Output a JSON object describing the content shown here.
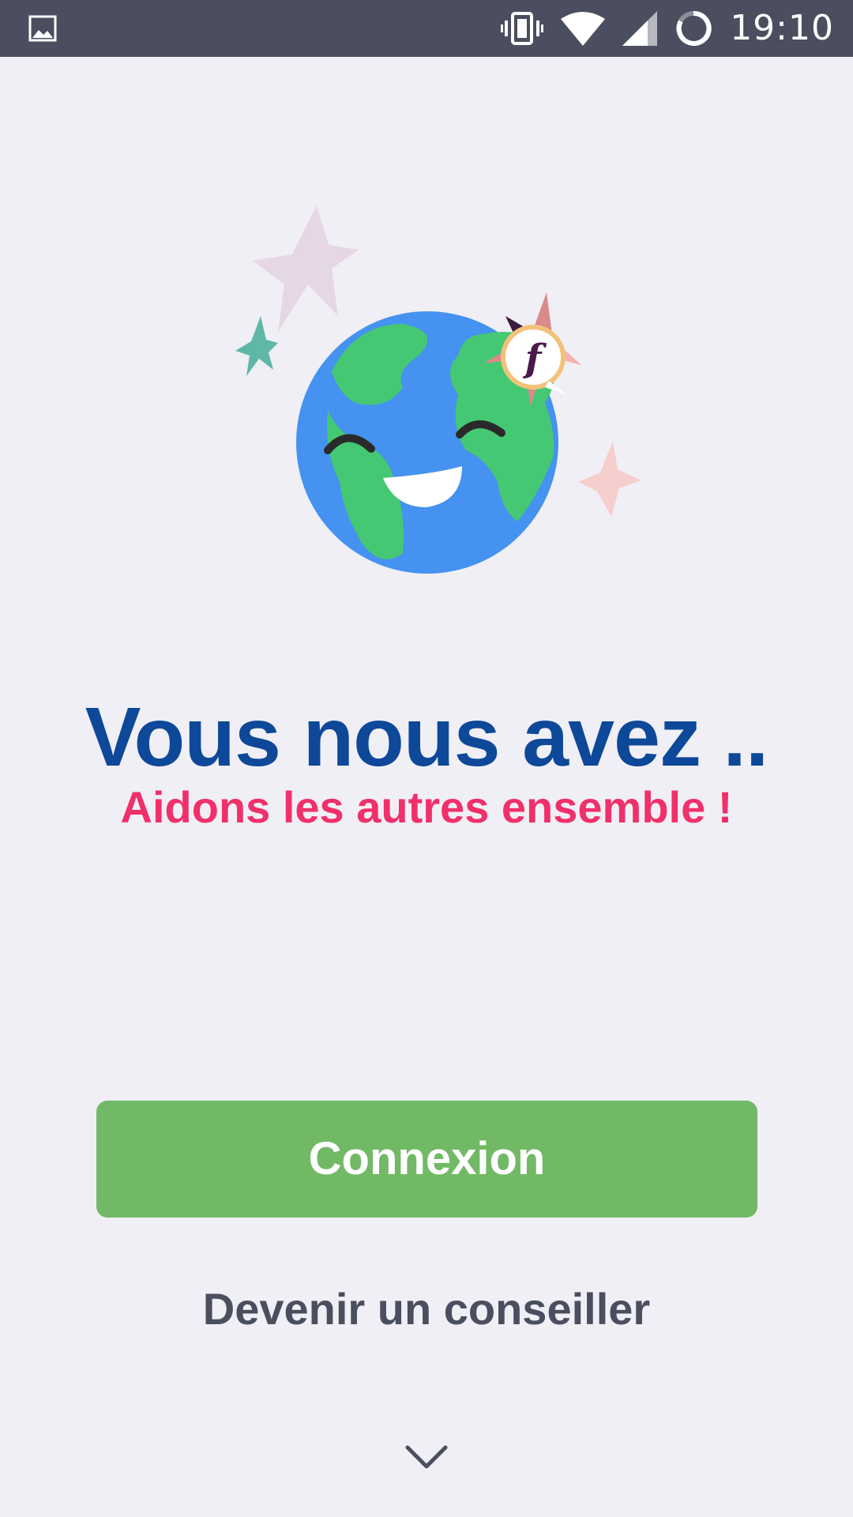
{
  "status_bar": {
    "time": "19:10",
    "icons": [
      "gallery-icon",
      "vibrate-icon",
      "wifi-icon",
      "signal-icon",
      "battery-icon"
    ]
  },
  "illustration": {
    "description_icons": [
      "earth-smiling-icon",
      "compass-logo-icon",
      "sparkle-icon"
    ],
    "logo_letter": "f"
  },
  "main": {
    "headline": "Vous nous avez ..",
    "subheadline": "Aidons les autres ensemble !"
  },
  "actions": {
    "login_label": "Connexion",
    "advisor_label": "Devenir un conseiller"
  },
  "colors": {
    "background": "#f0eff5",
    "status_bar": "#4a4e5e",
    "headline": "#0d4899",
    "subheadline": "#f0306a",
    "button": "#72b966",
    "link": "#4a4e5e"
  }
}
